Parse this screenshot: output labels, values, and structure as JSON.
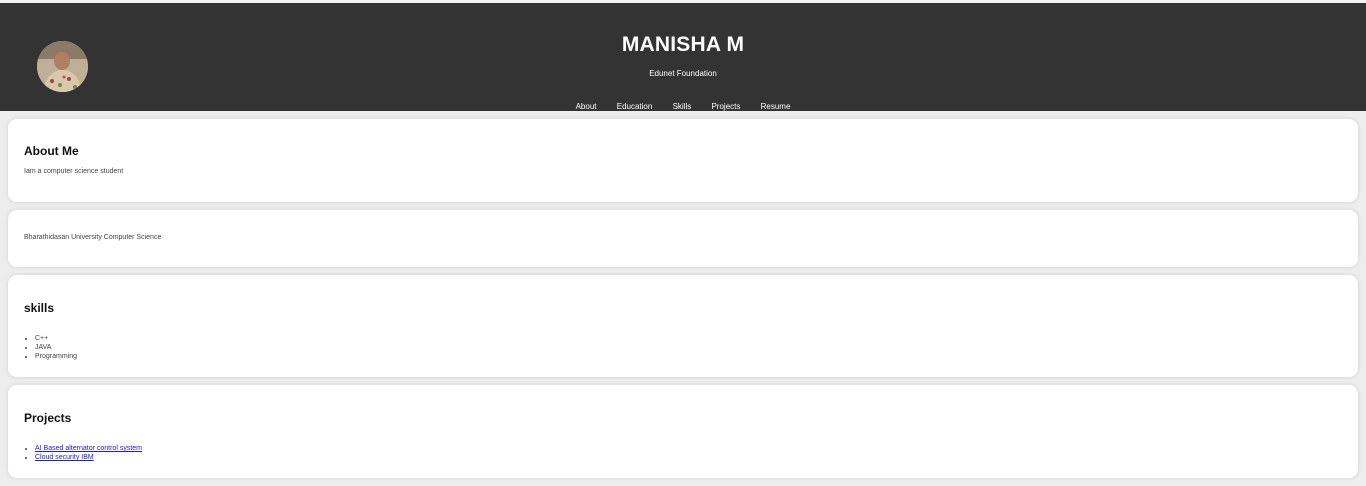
{
  "header": {
    "title": "MANISHA M",
    "subtitle": "Edunet Foundation",
    "avatar_icon": "profile-photo",
    "nav": [
      "About",
      "Education",
      "Skills",
      "Projects",
      "Resume"
    ]
  },
  "about": {
    "heading": "About Me",
    "text": "Iam a computer science student"
  },
  "education": {
    "text": "Bharathidasan University Computer Science"
  },
  "skills": {
    "heading": "skills",
    "items": [
      "C++",
      "JAVA",
      "Programming"
    ]
  },
  "projects": {
    "heading": "Projects",
    "items": [
      "AI Based alternator control system",
      "Cloud security IBM"
    ]
  },
  "colors": {
    "header_bg": "#333333",
    "page_bg": "#ededed",
    "card_bg": "#ffffff",
    "link": "#2020cc"
  }
}
